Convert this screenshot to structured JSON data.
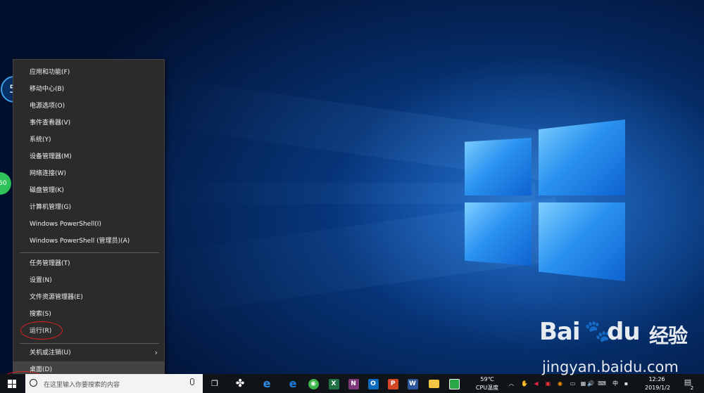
{
  "desktop": {
    "gadget_cpu": "5",
    "gadget_green": "50"
  },
  "context_menu": {
    "items_group1": [
      "应用和功能(F)",
      "移动中心(B)",
      "电源选项(O)",
      "事件查看器(V)",
      "系统(Y)",
      "设备管理器(M)",
      "网络连接(W)",
      "磁盘管理(K)",
      "计算机管理(G)",
      "Windows PowerShell(I)",
      "Windows PowerShell (管理员)(A)"
    ],
    "items_group2": [
      "任务管理器(T)",
      "设置(N)",
      "文件资源管理器(E)",
      "搜索(S)",
      "运行(R)"
    ],
    "items_group3": [
      "关机或注销(U)",
      "桌面(D)"
    ],
    "submenu_arrow": "›"
  },
  "taskbar": {
    "search_placeholder": "在这里输入你要搜索的内容",
    "apps": [
      {
        "name": "task-view",
        "glyph": "❐",
        "color": "#ffffff"
      },
      {
        "name": "fan",
        "glyph": "✤",
        "color": "#ffffff"
      },
      {
        "name": "ie",
        "glyph": "e",
        "color": "#2f8fe8"
      },
      {
        "name": "edge",
        "glyph": "e",
        "color": "#1a7fe0"
      },
      {
        "name": "360",
        "glyph": "●",
        "color": "#3bb54a"
      },
      {
        "name": "excel",
        "glyph": "X",
        "color": "#1f7244"
      },
      {
        "name": "onenote",
        "glyph": "N",
        "color": "#80397b"
      },
      {
        "name": "outlook",
        "glyph": "O",
        "color": "#0f6cbd"
      },
      {
        "name": "powerpoint",
        "glyph": "P",
        "color": "#d24726"
      },
      {
        "name": "word",
        "glyph": "W",
        "color": "#2b579a"
      },
      {
        "name": "explorer",
        "glyph": "▬",
        "color": "#f4c542"
      },
      {
        "name": "photos",
        "glyph": "◼",
        "color": "#27a845"
      }
    ],
    "cpu_temp": "59℃",
    "cpu_label": "CPU温度",
    "tray_ime": "中",
    "time": "12:26",
    "date": "2019/1/2",
    "notification_count": "2"
  },
  "watermark": {
    "brand": "Bai",
    "brand2": "du",
    "brand_cn": "经验",
    "site": "jingyan.baidu.com"
  }
}
